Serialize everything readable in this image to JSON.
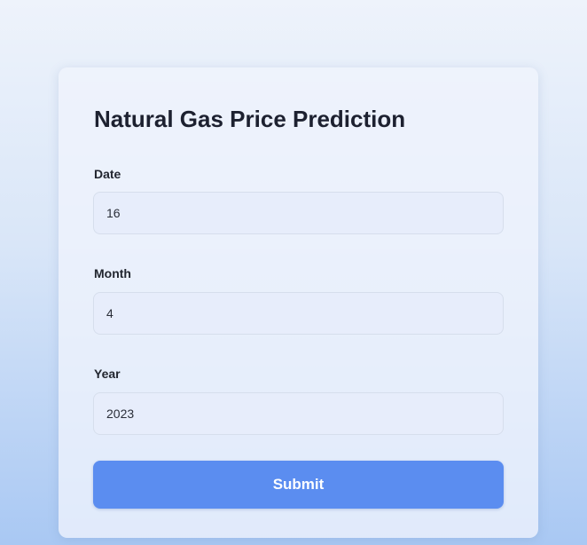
{
  "form": {
    "title": "Natural Gas Price Prediction",
    "fields": [
      {
        "label": "Date",
        "value": "16"
      },
      {
        "label": "Month",
        "value": "4"
      },
      {
        "label": "Year",
        "value": "2023"
      }
    ],
    "submit_label": "Submit"
  },
  "colors": {
    "button": "#5b8df0",
    "background_bottom": "#a9c8f3"
  }
}
